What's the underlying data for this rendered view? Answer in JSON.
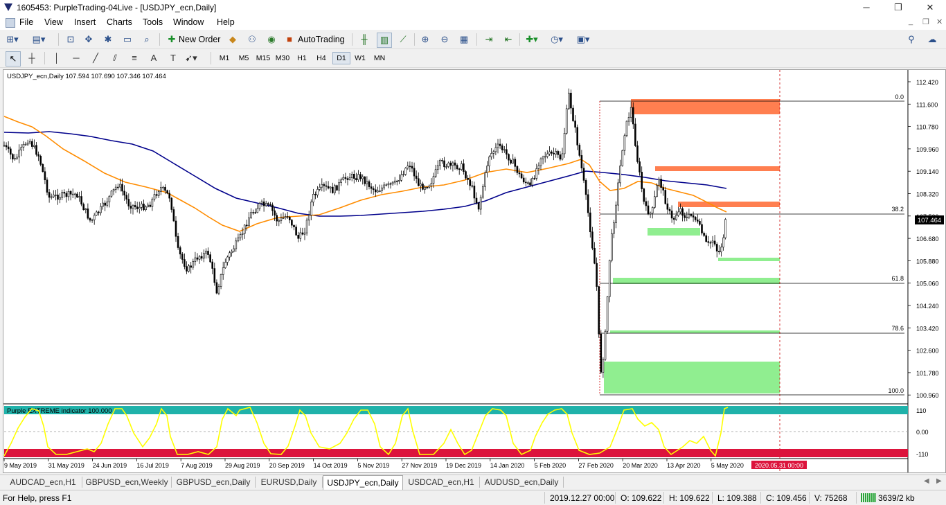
{
  "window": {
    "title": "1605453: PurpleTrading-04Live - [USDJPY_ecn,Daily]",
    "minimize": "─",
    "restore": "❐",
    "close": "✕"
  },
  "menu": {
    "items": [
      "File",
      "View",
      "Insert",
      "Charts",
      "Tools",
      "Window",
      "Help"
    ]
  },
  "toolbar": {
    "new_order": "New Order",
    "autotrading": "AutoTrading"
  },
  "timeframes": [
    "M1",
    "M5",
    "M15",
    "M30",
    "H1",
    "H4",
    "D1",
    "W1",
    "MN"
  ],
  "active_timeframe": "D1",
  "chart": {
    "header": "USDJPY_ecn,Daily  107.594 107.690 107.346 107.464",
    "current_price": "107.464",
    "price_axis": [
      "112.420",
      "111.600",
      "110.780",
      "109.960",
      "109.140",
      "108.320",
      "107.500",
      "106.680",
      "105.880",
      "105.060",
      "104.240",
      "103.420",
      "102.600",
      "101.780",
      "100.960"
    ],
    "date_axis": [
      "9 May 2019",
      "31 May 2019",
      "24 Jun 2019",
      "16 Jul 2019",
      "7 Aug 2019",
      "29 Aug 2019",
      "20 Sep 2019",
      "14 Oct 2019",
      "5 Nov 2019",
      "27 Nov 2019",
      "19 Dec 2019",
      "14 Jan 2020",
      "5 Feb 2020",
      "27 Feb 2020",
      "20 Mar 2020",
      "13 Apr 2020",
      "5 May 2020"
    ],
    "cursor_date": "2020.05.31 00:00",
    "fib_levels": [
      "0.0",
      "38.2",
      "61.8",
      "78.6",
      "100.0"
    ],
    "colors": {
      "resistance_zone": "#ff7f50",
      "support_zone": "#90ee90",
      "ma_fast": "#ff8c00",
      "ma_slow": "#00008b",
      "oscillator": "#ffff00",
      "osc_high_band": "#20b2aa",
      "osc_low_band": "#dc143c"
    }
  },
  "indicator": {
    "label": "Purple EXTREME indicator 100.000",
    "axis": [
      "110",
      "0.00",
      "-110"
    ]
  },
  "tabs": [
    "AUDCAD_ecn,H1",
    "GBPUSD_ecn,Weekly",
    "GBPUSD_ecn,Daily",
    "EURUSD,Daily",
    "USDJPY_ecn,Daily",
    "USDCAD_ecn,H1",
    "AUDUSD_ecn,Daily"
  ],
  "active_tab": "USDJPY_ecn,Daily",
  "status": {
    "help": "For Help, press F1",
    "datetime": "2019.12.27 00:00",
    "open": "O: 109.622",
    "high": "H: 109.622",
    "low": "L: 109.388",
    "close": "C: 109.456",
    "volume": "V: 75268",
    "traffic": "3639/2 kb"
  }
}
